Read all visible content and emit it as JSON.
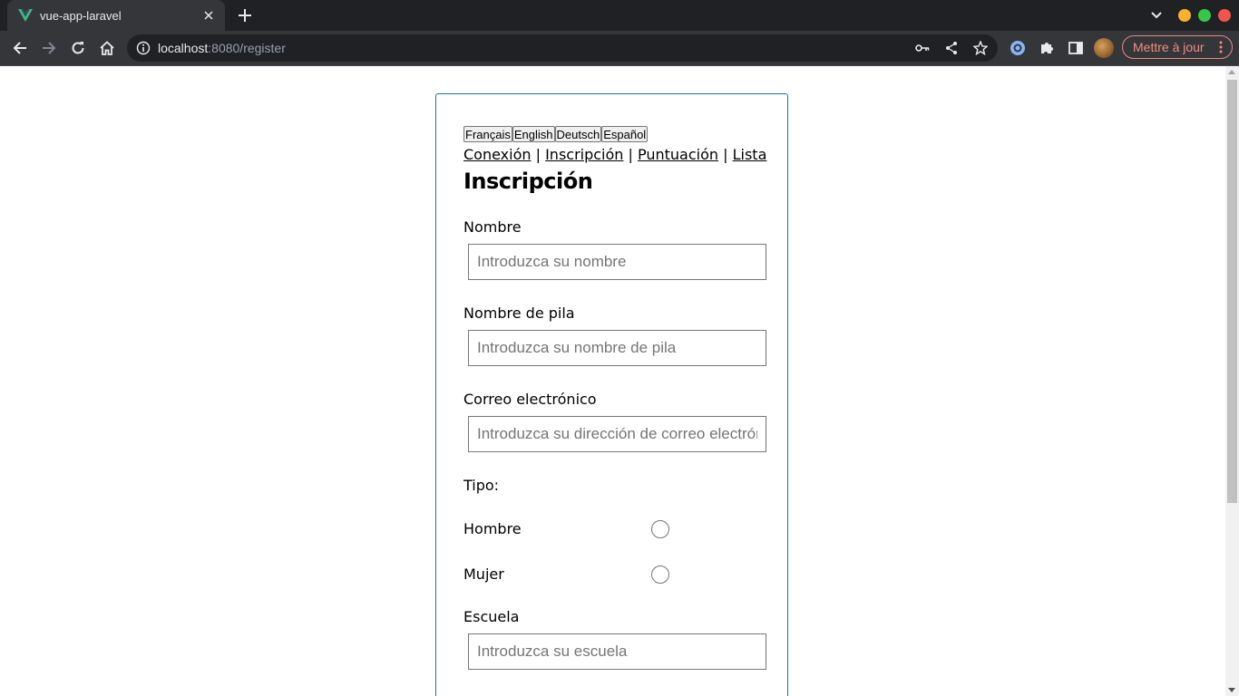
{
  "browser": {
    "tab_title": "vue-app-laravel",
    "url_host": "localhost",
    "url_path": ":8080/register",
    "update_label": "Mettre à jour",
    "accent": "#f28b82"
  },
  "languages": [
    "Français",
    "English",
    "Deutsch",
    "Español"
  ],
  "nav": {
    "login": "Conexión",
    "register": "Inscripción",
    "score": "Puntuación",
    "list": "Lista",
    "separator": " | "
  },
  "form": {
    "title": "Inscripción",
    "last_name_label": "Nombre",
    "last_name_placeholder": "Introduzca su nombre",
    "first_name_label": "Nombre de pila",
    "first_name_placeholder": "Introduzca su nombre de pila",
    "email_label": "Correo electrónico",
    "email_placeholder": "Introduzca su dirección de correo electrónico",
    "type_label": "Tipo:",
    "option_male": "Hombre",
    "option_female": "Mujer",
    "school_label": "Escuela",
    "school_placeholder": "Introduzca su escuela"
  },
  "icons": [
    "vue-favicon",
    "close-icon",
    "plus-icon",
    "chevron-down-icon",
    "back-arrow-icon",
    "forward-arrow-icon",
    "reload-icon",
    "home-icon",
    "info-icon",
    "key-icon",
    "share-icon",
    "star-icon",
    "extension-icon",
    "puzzle-icon",
    "sidebar-icon",
    "kebab-icon"
  ]
}
